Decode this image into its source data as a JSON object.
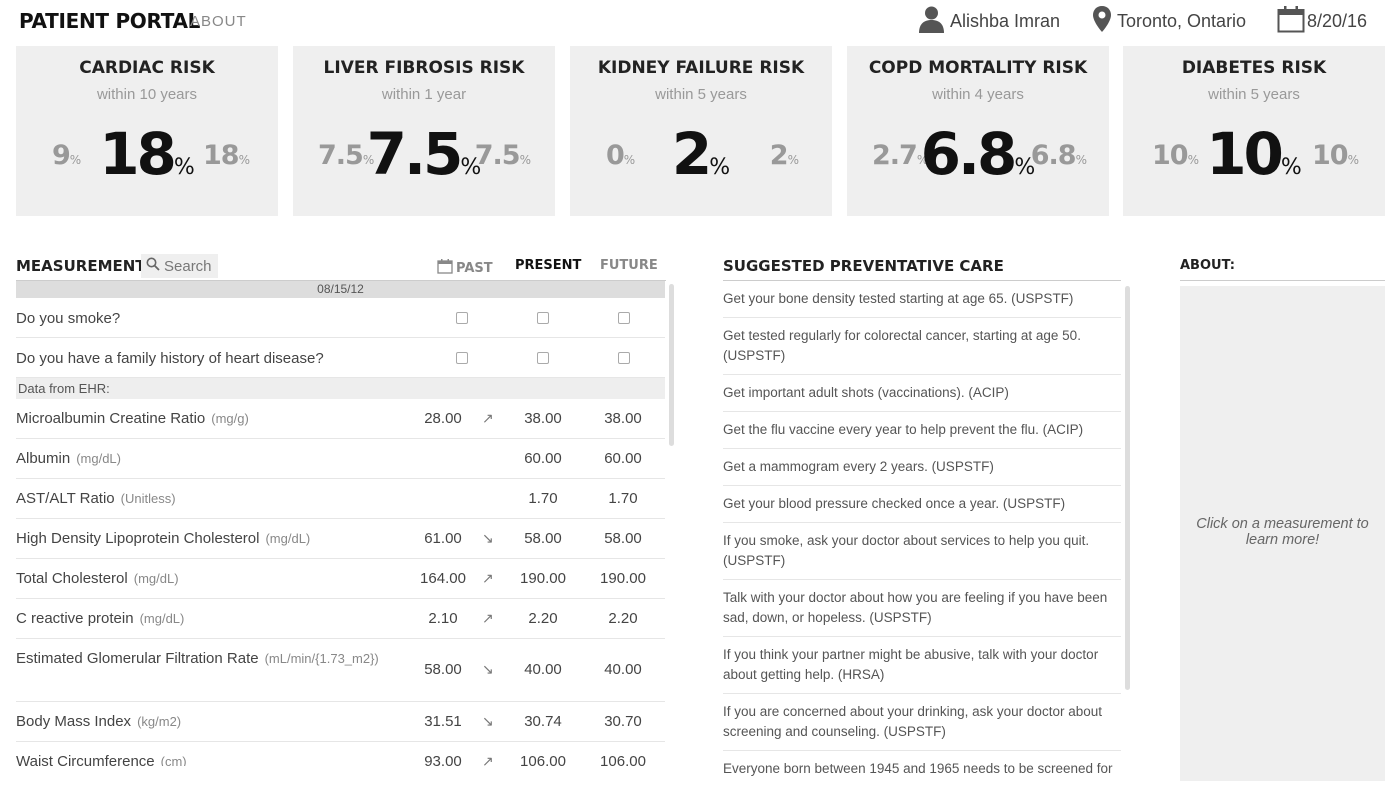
{
  "header": {
    "brand": "PATIENT PORTAL",
    "about_link": "ABOUT",
    "user_name": "Alishba Imran",
    "location": "Toronto, Ontario",
    "date": "8/20/16"
  },
  "risks": [
    {
      "title": "CARDIAC RISK",
      "sub": "within 10 years",
      "past": "9",
      "main": "18",
      "future": "18"
    },
    {
      "title": "LIVER FIBROSIS RISK",
      "sub": "within 1 year",
      "past": "7.5",
      "main": "7.5",
      "future": "7.5"
    },
    {
      "title": "KIDNEY FAILURE RISK",
      "sub": "within 5 years",
      "past": "0",
      "main": "2",
      "future": "2"
    },
    {
      "title": "COPD MORTALITY RISK",
      "sub": "within 4 years",
      "past": "2.7",
      "main": "6.8",
      "future": "6.8"
    },
    {
      "title": "DIABETES RISK",
      "sub": "within 5 years",
      "past": "10",
      "main": "10",
      "future": "10"
    }
  ],
  "pct": "%",
  "measurements": {
    "title": "MEASUREMENTS",
    "search_placeholder": "Search",
    "col_past": "PAST",
    "col_present": "PRESENT",
    "col_future": "FUTURE",
    "past_date": "08/15/12",
    "questions": [
      "Do you smoke?",
      "Do you have a family history of heart disease?"
    ],
    "ehr_label": "Data from EHR:",
    "rows": [
      {
        "name": "Microalbumin Creatine Ratio",
        "unit": "(mg/g)",
        "past": "28.00",
        "arrow": "↗",
        "present": "38.00",
        "future": "38.00"
      },
      {
        "name": "Albumin",
        "unit": "(mg/dL)",
        "past": "",
        "arrow": "",
        "present": "60.00",
        "future": "60.00"
      },
      {
        "name": "AST/ALT Ratio",
        "unit": "(Unitless)",
        "past": "",
        "arrow": "",
        "present": "1.70",
        "future": "1.70"
      },
      {
        "name": "High Density Lipoprotein Cholesterol",
        "unit": "(mg/dL)",
        "past": "61.00",
        "arrow": "↘",
        "present": "58.00",
        "future": "58.00"
      },
      {
        "name": "Total Cholesterol",
        "unit": "(mg/dL)",
        "past": "164.00",
        "arrow": "↗",
        "present": "190.00",
        "future": "190.00"
      },
      {
        "name": "C reactive protein",
        "unit": "(mg/dL)",
        "past": "2.10",
        "arrow": "↗",
        "present": "2.20",
        "future": "2.20"
      },
      {
        "name": "Estimated Glomerular Filtration Rate",
        "unit": "(mL/min/{1.73_m2})",
        "past": "58.00",
        "arrow": "↘",
        "present": "40.00",
        "future": "40.00"
      },
      {
        "name": "Body Mass Index",
        "unit": "(kg/m2)",
        "past": "31.51",
        "arrow": "↘",
        "present": "30.74",
        "future": "30.70"
      },
      {
        "name": "Waist Circumference",
        "unit": "(cm)",
        "past": "93.00",
        "arrow": "↗",
        "present": "106.00",
        "future": "106.00"
      }
    ]
  },
  "care": {
    "title": "SUGGESTED PREVENTATIVE CARE",
    "items": [
      "Get your bone density tested starting at age 65. (USPSTF)",
      "Get tested regularly for colorectal cancer, starting at age 50. (USPSTF)",
      "Get important adult shots (vaccinations). (ACIP)",
      "Get the flu vaccine every year to help prevent the flu. (ACIP)",
      "Get a mammogram every 2 years. (USPSTF)",
      "Get your blood pressure checked once a year. (USPSTF)",
      "If you smoke, ask your doctor about services to help you quit. (USPSTF)",
      "Talk with your doctor about how you are feeling if you have been sad, down, or hopeless. (USPSTF)",
      "If you think your partner might be abusive, talk with your doctor about getting help. (HRSA)",
      "If you are concerned about your drinking, ask your doctor about screening and counseling. (USPSTF)",
      "Everyone born between 1945 and 1965 needs to be screened for"
    ]
  },
  "about": {
    "title": "ABOUT:",
    "hint": "Click on a measurement to learn more!"
  }
}
